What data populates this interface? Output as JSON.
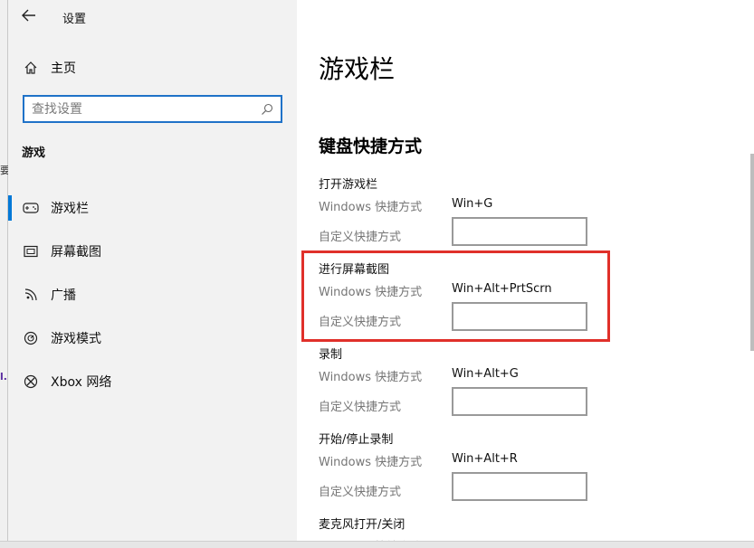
{
  "window": {
    "title": "设置"
  },
  "sidebar": {
    "home_label": "主页",
    "search_placeholder": "查找设置",
    "section_heading": "游戏",
    "items": [
      {
        "label": "游戏栏",
        "icon": "gamebar-icon",
        "selected": true
      },
      {
        "label": "屏幕截图",
        "icon": "capture-icon",
        "selected": false
      },
      {
        "label": "广播",
        "icon": "broadcast-icon",
        "selected": false
      },
      {
        "label": "游戏模式",
        "icon": "gamemode-icon",
        "selected": false
      },
      {
        "label": "Xbox 网络",
        "icon": "xbox-icon",
        "selected": false
      }
    ]
  },
  "main": {
    "page_title": "游戏栏",
    "section_heading": "键盘快捷方式",
    "windows_shortcut_label": "Windows 快捷方式",
    "custom_shortcut_label": "自定义快捷方式",
    "groups": [
      {
        "title": "打开游戏栏",
        "shortcut": "Win+G",
        "custom": ""
      },
      {
        "title": "进行屏幕截图",
        "shortcut": "Win+Alt+PrtScrn",
        "custom": ""
      },
      {
        "title": "录制",
        "shortcut": "Win+Alt+G",
        "custom": ""
      },
      {
        "title": "开始/停止录制",
        "shortcut": "Win+Alt+R",
        "custom": ""
      },
      {
        "title": "麦克风打开/关闭",
        "shortcut": "",
        "custom": ""
      }
    ]
  },
  "background_fragments": [
    "要",
    "l."
  ],
  "colors": {
    "accent": "#0078d7",
    "highlight": "#e0302a",
    "sidebar_bg": "#f2f2f2"
  }
}
